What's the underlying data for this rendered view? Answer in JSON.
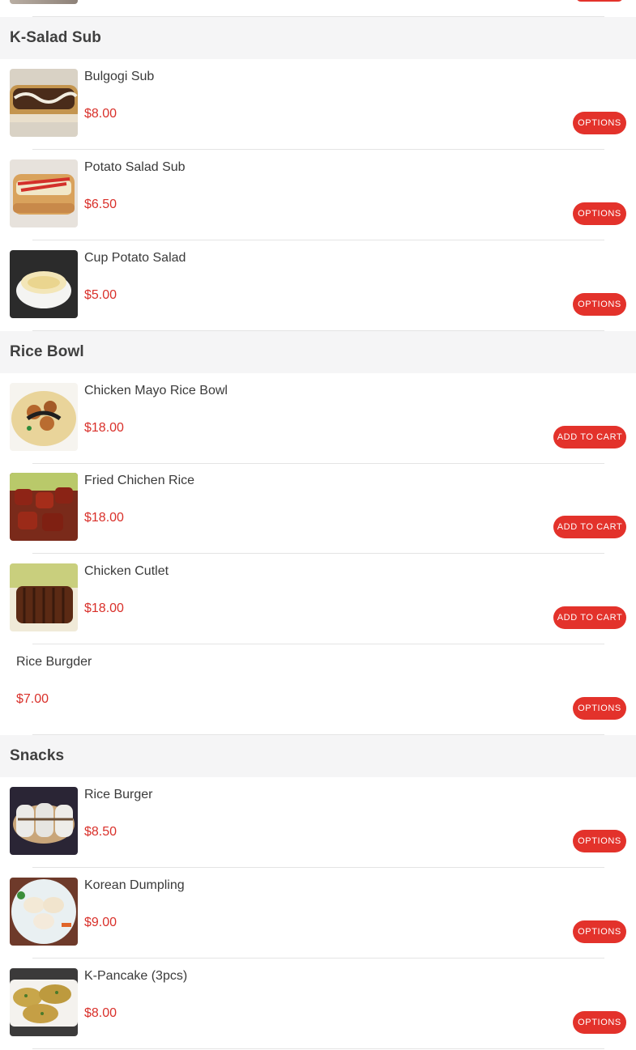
{
  "sections": [
    {
      "title": "K-Salad Sub",
      "items": [
        {
          "name": "Bulgogi Sub",
          "price": "$8.00",
          "button": "OPTIONS"
        },
        {
          "name": "Potato Salad Sub",
          "price": "$6.50",
          "button": "OPTIONS"
        },
        {
          "name": "Cup Potato Salad",
          "price": "$5.00",
          "button": "OPTIONS"
        }
      ]
    },
    {
      "title": "Rice Bowl",
      "items": [
        {
          "name": "Chicken Mayo Rice Bowl",
          "price": "$18.00",
          "button": "ADD TO CART"
        },
        {
          "name": "Fried Chichen Rice",
          "price": "$18.00",
          "button": "ADD TO CART"
        },
        {
          "name": "Chicken Cutlet",
          "price": "$18.00",
          "button": "ADD TO CART"
        },
        {
          "name": "Rice Burgder",
          "price": "$7.00",
          "button": "OPTIONS"
        }
      ]
    },
    {
      "title": "Snacks",
      "items": [
        {
          "name": "Rice Burger",
          "price": "$8.50",
          "button": "OPTIONS"
        },
        {
          "name": "Korean Dumpling",
          "price": "$9.00",
          "button": "OPTIONS"
        },
        {
          "name": "K-Pancake (3pcs)",
          "price": "$8.00",
          "button": "OPTIONS"
        }
      ]
    }
  ],
  "colors": {
    "accent": "#e3322b",
    "price": "#d9302a",
    "section_bg": "#f5f5f6"
  }
}
